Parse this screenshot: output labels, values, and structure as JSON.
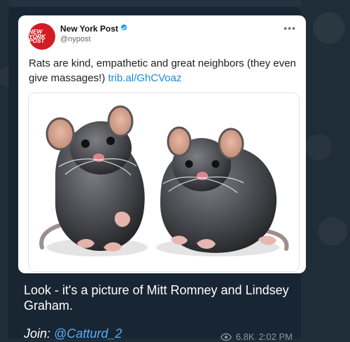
{
  "tweet": {
    "avatar_label": "NEW YORK POST",
    "name": "New York Post",
    "handle": "@nypost",
    "text": "Rats are kind, empathetic and great neighbors (they even give massages!)",
    "link": "trib.al/GhCVoaz"
  },
  "caption": {
    "line1": "Look - it's a picture of Mitt Romney and Lindsey Graham.",
    "join_label": "Join:",
    "join_link": "@Catturd_2"
  },
  "meta": {
    "views": "6.8K",
    "time": "2:02 PM"
  },
  "colors": {
    "chat_bg": "#1f2d38",
    "bubble_bg": "#182533",
    "card_bg": "#ffffff",
    "link_blue": "#1d89d8",
    "telegram_link": "#5aaef6",
    "avatar_red": "#d21d25",
    "verified_blue": "#1d9bf0"
  }
}
